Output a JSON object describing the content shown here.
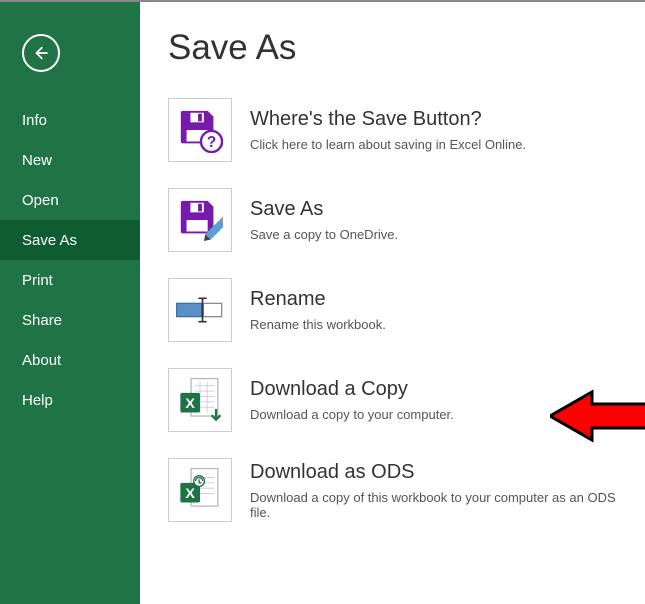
{
  "page_title": "Save As",
  "sidebar": {
    "items": [
      {
        "label": "Info",
        "active": false
      },
      {
        "label": "New",
        "active": false
      },
      {
        "label": "Open",
        "active": false
      },
      {
        "label": "Save As",
        "active": true
      },
      {
        "label": "Print",
        "active": false
      },
      {
        "label": "Share",
        "active": false
      },
      {
        "label": "About",
        "active": false
      },
      {
        "label": "Help",
        "active": false
      }
    ]
  },
  "options": [
    {
      "id": "where-save-button",
      "icon": "floppy-question-icon",
      "title": "Where's the Save Button?",
      "desc": "Click here to learn about saving in Excel Online."
    },
    {
      "id": "save-as",
      "icon": "floppy-pencil-icon",
      "title": "Save As",
      "desc": "Save a copy to OneDrive."
    },
    {
      "id": "rename",
      "icon": "rename-icon",
      "title": "Rename",
      "desc": "Rename this workbook."
    },
    {
      "id": "download-copy",
      "icon": "excel-download-icon",
      "title": "Download a Copy",
      "desc": "Download a copy to your computer."
    },
    {
      "id": "download-ods",
      "icon": "ods-download-icon",
      "title": "Download as ODS",
      "desc": "Download a copy of this workbook to your computer as an ODS file."
    }
  ],
  "colors": {
    "sidebar_bg": "#207347",
    "accent": "#7719aa",
    "excel": "#1f7246"
  }
}
